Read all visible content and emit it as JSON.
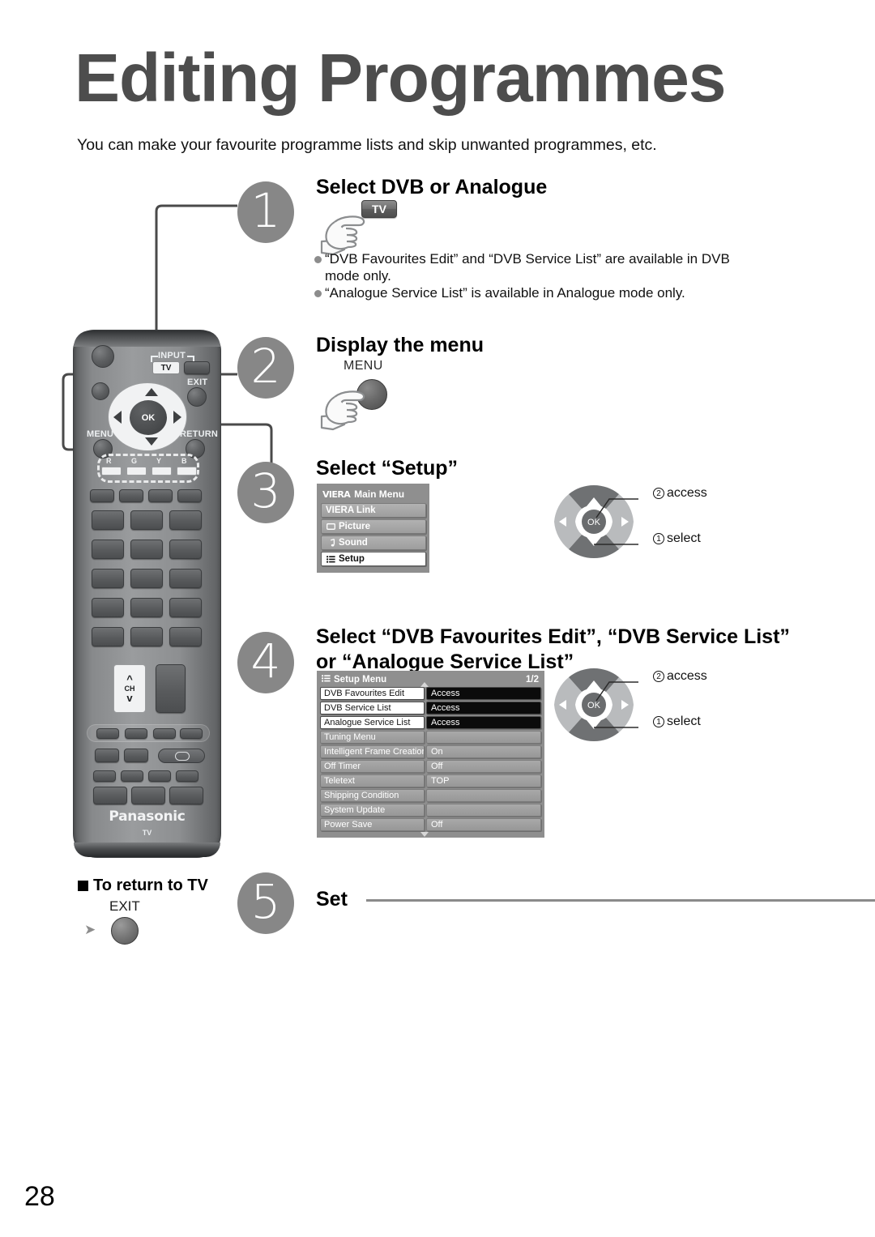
{
  "page": {
    "title": "Editing Programmes",
    "subtitle": "You can make your favourite programme lists and skip unwanted programmes, etc.",
    "page_number": "28"
  },
  "steps": [
    {
      "number": "1",
      "heading": "Select DVB or Analogue"
    },
    {
      "number": "2",
      "heading": "Display the menu"
    },
    {
      "number": "3",
      "heading": "Select “Setup”"
    },
    {
      "number": "4",
      "heading": "Select “DVB Favourites Edit”, “DVB Service List” or “Analogue Service List”"
    },
    {
      "number": "5",
      "heading": "Set"
    }
  ],
  "step1": {
    "key_label": "TV",
    "notes": [
      "“DVB Favourites Edit” and “DVB Service List” are available in DVB mode only.",
      "“Analogue Service List” is available in Analogue mode only."
    ]
  },
  "step2": {
    "key_label": "MENU"
  },
  "viera_menu": {
    "logo": "VIERA",
    "title": "Main Menu",
    "items": [
      {
        "label": "VIERA Link",
        "icon": "",
        "selected": false
      },
      {
        "label": "Picture",
        "icon": "picture-icon",
        "selected": false
      },
      {
        "label": "Sound",
        "icon": "sound-icon",
        "selected": false
      },
      {
        "label": "Setup",
        "icon": "list-icon",
        "selected": true
      }
    ]
  },
  "setup_menu": {
    "title": "Setup Menu",
    "pagination": "1/2",
    "rows": [
      {
        "label": "DVB Favourites Edit",
        "value": "Access",
        "highlight": true
      },
      {
        "label": "DVB Service List",
        "value": "Access",
        "highlight": true
      },
      {
        "label": "Analogue Service List",
        "value": "Access",
        "highlight": true
      },
      {
        "label": "Tuning Menu",
        "value": "",
        "highlight": false
      },
      {
        "label": "Intelligent Frame Creation",
        "value": "On",
        "highlight": false
      },
      {
        "label": "Off Timer",
        "value": "Off",
        "highlight": false
      },
      {
        "label": "Teletext",
        "value": "TOP",
        "highlight": false
      },
      {
        "label": "Shipping Condition",
        "value": "",
        "highlight": false
      },
      {
        "label": "System Update",
        "value": "",
        "highlight": false
      },
      {
        "label": "Power Save",
        "value": "Off",
        "highlight": false
      }
    ]
  },
  "wheel": {
    "ok_label": "OK",
    "note_access_num": "2",
    "note_access": "access",
    "note_select_num": "1",
    "note_select": "select"
  },
  "return_to_tv": {
    "title": "To return to TV",
    "key_label": "EXIT"
  },
  "remote": {
    "brand": "Panasonic",
    "brand_sub": "TV",
    "labels": {
      "input": "INPUT",
      "tv": "TV",
      "exit": "EXIT",
      "menu": "MENU",
      "return": "RETURN",
      "ok": "OK",
      "ch": "CH",
      "color_r": "R",
      "color_g": "G",
      "color_y": "Y",
      "color_b": "B"
    }
  },
  "colors": {
    "title_gray": "#4d4d4d",
    "step_circle": "#878787",
    "panel_bg": "#8f8f8f",
    "highlight_value_bg": "#0b0b0b",
    "rule": "#8a8a8a"
  }
}
